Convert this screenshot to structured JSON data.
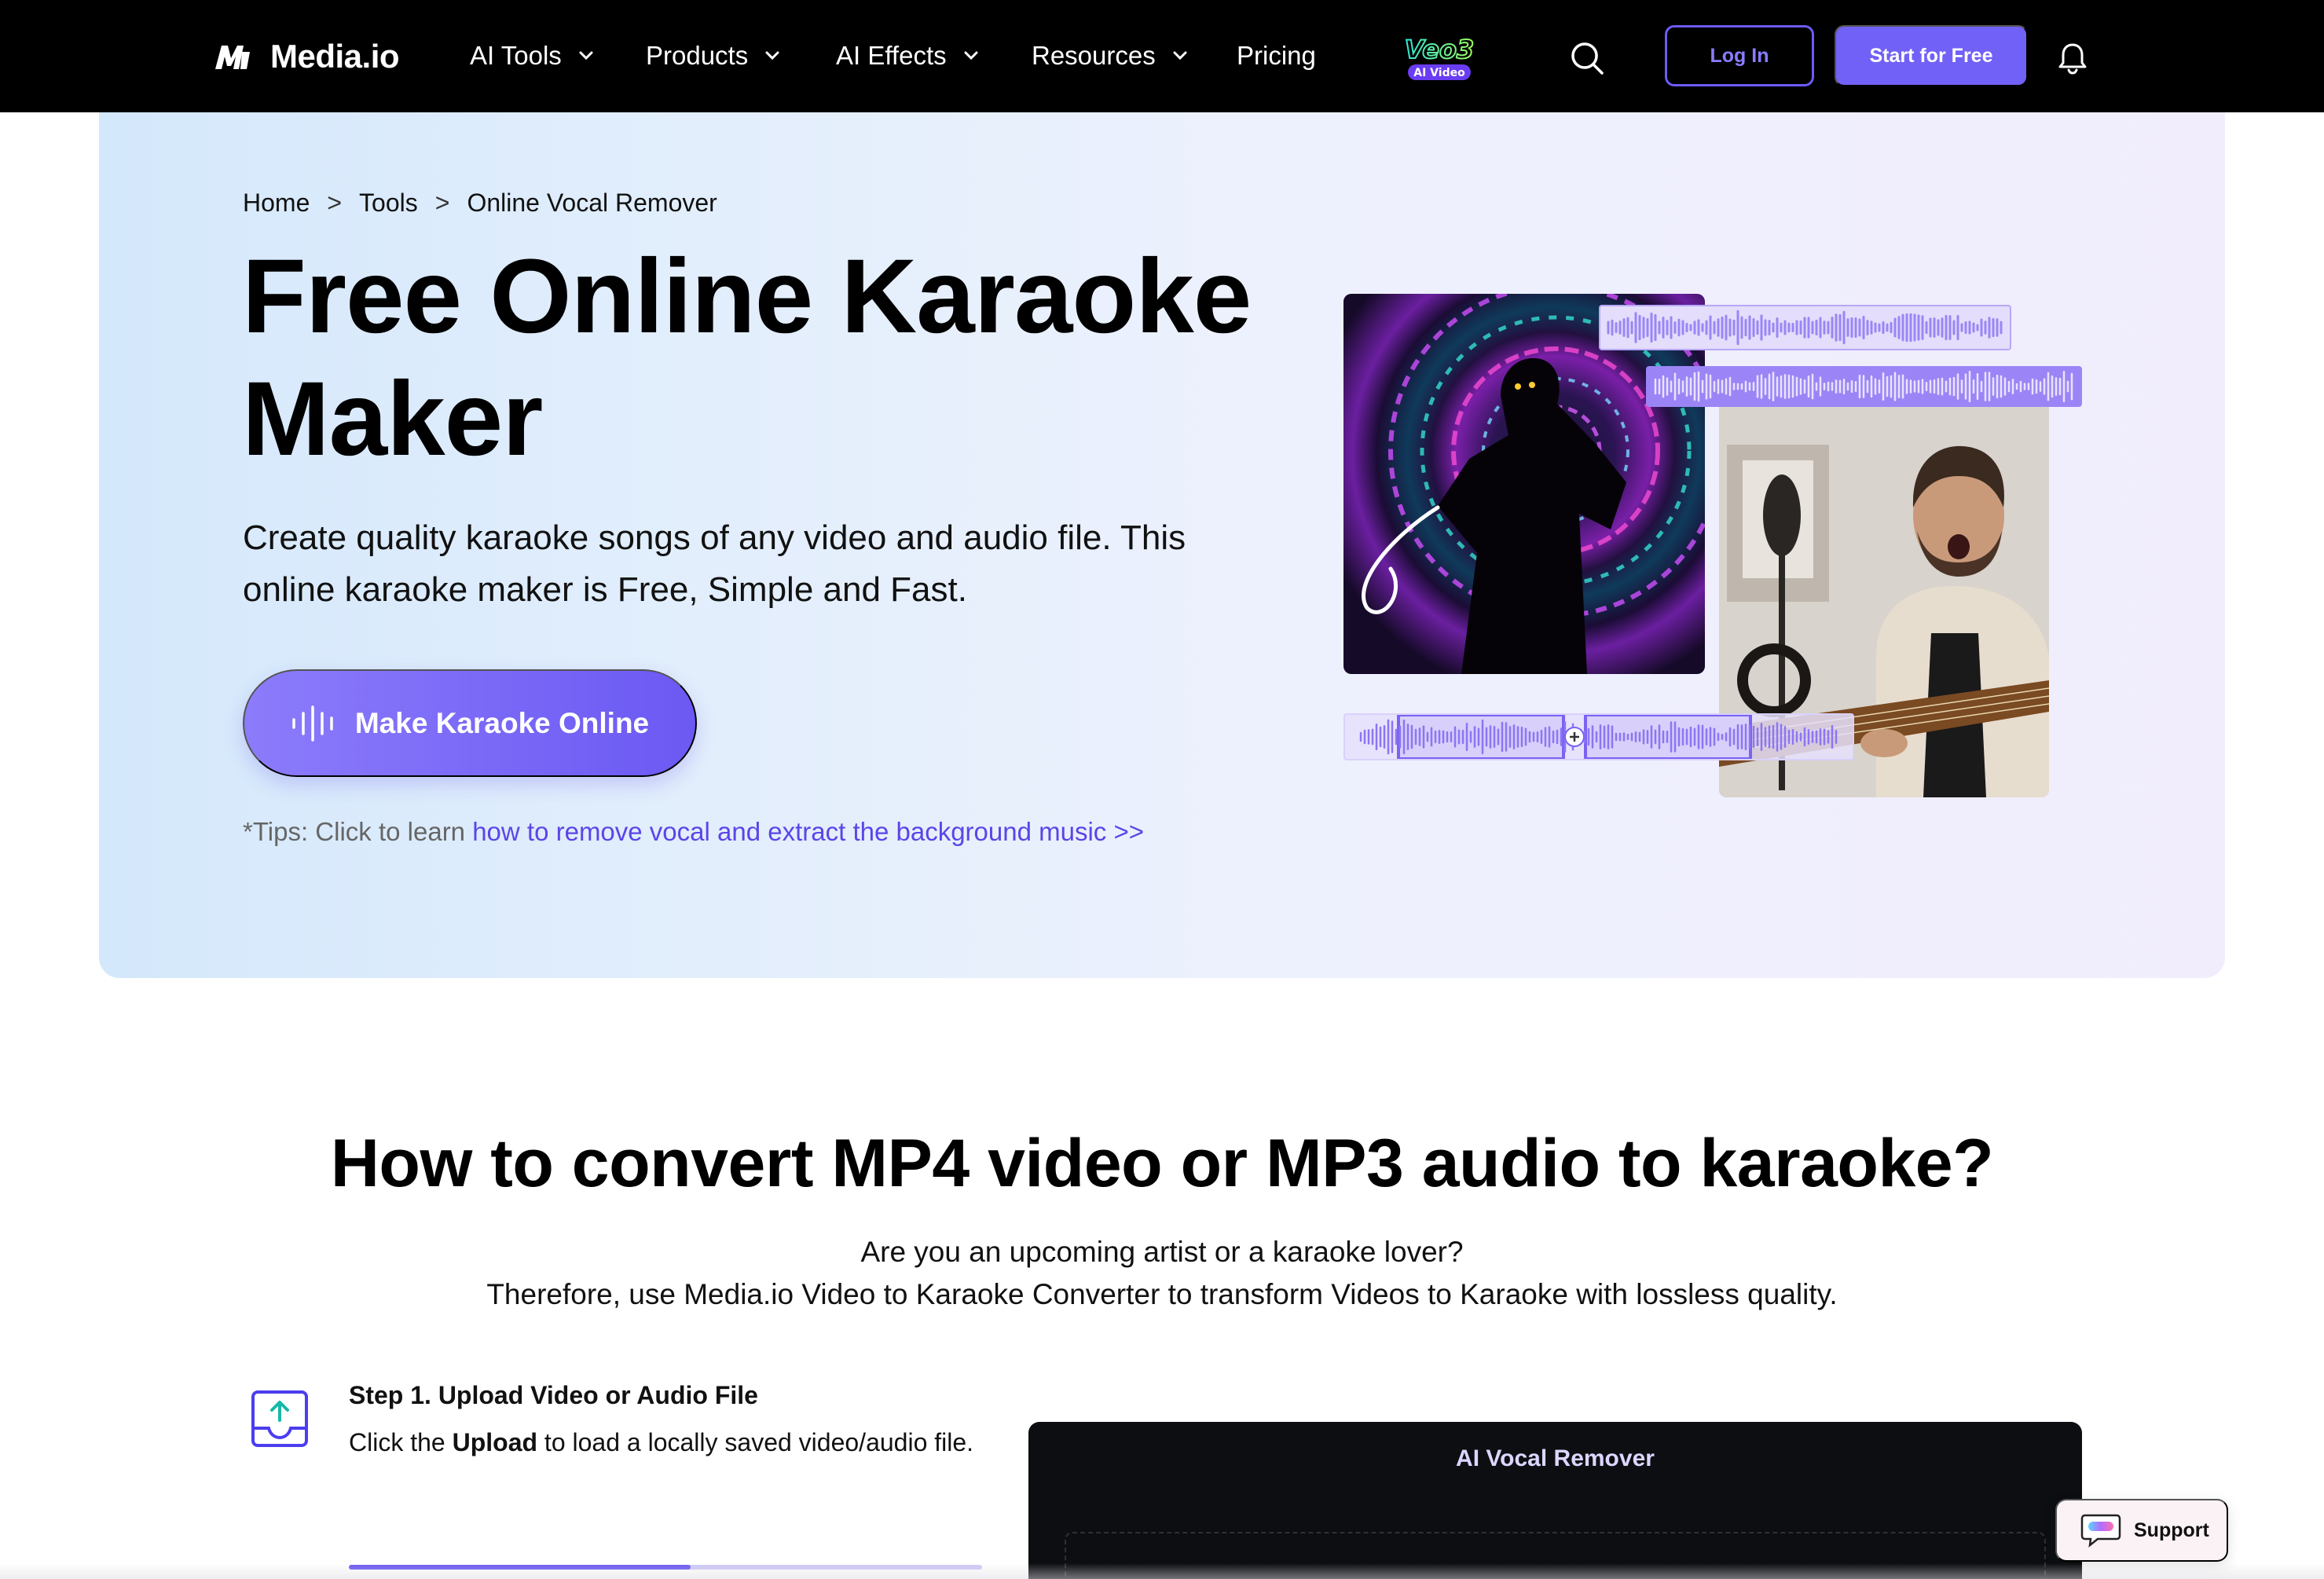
{
  "nav": {
    "logo_text": "Media.io",
    "items": [
      {
        "label": "AI Tools",
        "has_dropdown": true
      },
      {
        "label": "Products",
        "has_dropdown": true
      },
      {
        "label": "AI Effects",
        "has_dropdown": true
      },
      {
        "label": "Resources",
        "has_dropdown": true
      },
      {
        "label": "Pricing",
        "has_dropdown": false
      }
    ],
    "promo_badge": {
      "brand": "Veo3",
      "tag": "AI Video"
    },
    "login_label": "Log In",
    "start_label": "Start for Free",
    "icons": [
      "search-icon",
      "bell-icon"
    ]
  },
  "hero": {
    "breadcrumb": [
      "Home",
      "Tools",
      "Online Vocal Remover"
    ],
    "breadcrumb_sep": ">",
    "title_line1": "Free Online Karaoke",
    "title_line2": "Maker",
    "subtitle": "Create quality karaoke songs of any video and audio file. This online karaoke maker is Free, Simple and Fast.",
    "cta_label": "Make Karaoke Online",
    "tips_prefix": "*Tips: Click to learn ",
    "tips_link": "how to remove vocal and extract the background music >>"
  },
  "how": {
    "title": "How to convert MP4 video or MP3 audio to karaoke?",
    "line1": "Are you an upcoming artist or a karaoke lover?",
    "line2": "Therefore, use Media.io Video to Karaoke Converter to transform Videos to Karaoke with lossless quality.",
    "step": {
      "title": "Step 1. Upload Video or Audio File",
      "desc_prefix": "Click the ",
      "desc_bold": "Upload",
      "desc_suffix": " to load a locally saved video/audio file.",
      "progress": 0.54
    },
    "demo_title": "AI Vocal Remover"
  },
  "support_label": "Support",
  "colors": {
    "accent": "#7261f6",
    "nav_bg": "#000000",
    "link": "#5b45e8"
  }
}
